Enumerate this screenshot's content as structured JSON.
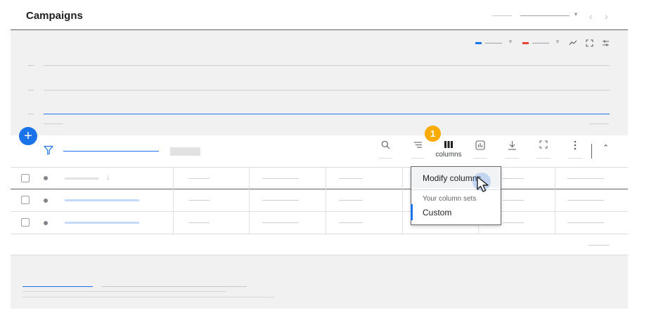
{
  "header": {
    "title": "Campaigns"
  },
  "toolbar": {
    "columns_label": "columns",
    "step_badge": "1"
  },
  "columns_menu": {
    "modify_columns": "Modify columns",
    "section_label": "Your column sets",
    "custom_set": "Custom"
  },
  "colors": {
    "accent_blue": "#1a73e8",
    "metric_red": "#ea4335",
    "badge_amber": "#f9ab00"
  },
  "icons": [
    "plus-icon",
    "filter-icon",
    "search-icon",
    "segment-icon",
    "columns-icon",
    "reports-icon",
    "download-icon",
    "expand-icon",
    "more-vert-icon",
    "chevron-up-icon",
    "chevron-left-icon",
    "chevron-right-icon",
    "trend-icon",
    "adjust-icon",
    "arrow-down-icon",
    "pointer-cursor-icon"
  ]
}
